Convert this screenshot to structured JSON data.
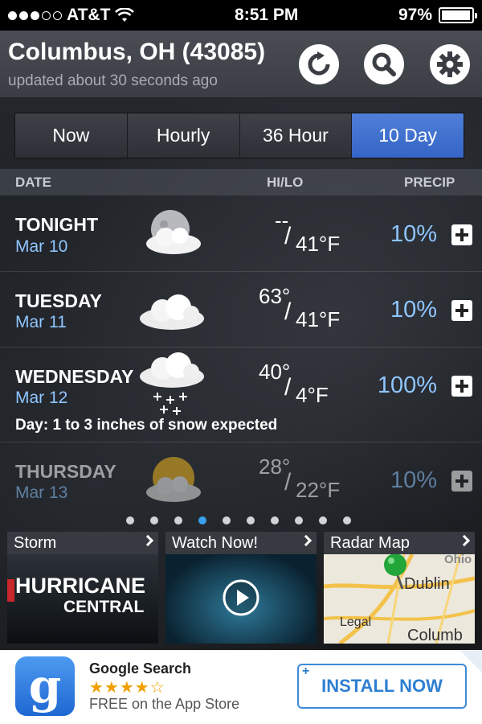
{
  "status_bar": {
    "carrier": "AT&T",
    "time": "8:51 PM",
    "battery": "97%",
    "battery_level": 0.97
  },
  "header": {
    "location": "Columbus, OH (43085)",
    "updated": "updated about 30 seconds ago",
    "icons": [
      "refresh-icon",
      "search-icon",
      "gear-icon"
    ]
  },
  "tabs": [
    {
      "label": "Now",
      "active": false
    },
    {
      "label": "Hourly",
      "active": false
    },
    {
      "label": "36 Hour",
      "active": false
    },
    {
      "label": "10 Day",
      "active": true
    }
  ],
  "columns": {
    "date": "DATE",
    "hilo": "HI/LO",
    "precip": "PRECIP"
  },
  "forecast": [
    {
      "day": "TONIGHT",
      "date": "Mar 10",
      "hi": "--",
      "lo": "41°F",
      "precip": "10%",
      "icon": "moon-cloud-icon",
      "note": ""
    },
    {
      "day": "TUESDAY",
      "date": "Mar 11",
      "hi": "63°",
      "lo": "41°F",
      "precip": "10%",
      "icon": "cloud-icon",
      "note": ""
    },
    {
      "day": "WEDNESDAY",
      "date": "Mar 12",
      "hi": "40°",
      "lo": "4°F",
      "precip": "100%",
      "icon": "snow-cloud-icon",
      "note": "Day: 1 to 3 inches of snow expected"
    },
    {
      "day": "THURSDAY",
      "date": "Mar 13",
      "hi": "28°",
      "lo": "22°F",
      "precip": "10%",
      "icon": "sun-cloud-icon",
      "note": ""
    }
  ],
  "pagination": {
    "count": 10,
    "active_index": 3
  },
  "cards": [
    {
      "title": "Storm",
      "caption_line1": "HURRICANE",
      "caption_line2": "CENTRAL"
    },
    {
      "title": "Watch Now!"
    },
    {
      "title": "Radar Map",
      "labels": [
        "Ohio",
        "Dublin",
        "Legal",
        "Columb"
      ]
    }
  ],
  "ad": {
    "title": "Google Search",
    "rating": "★★★★☆",
    "subtitle": "FREE on the App Store",
    "button": "INSTALL NOW",
    "button_plus": "+",
    "logo_letter": "g",
    "colors": {
      "accent": "#3c8bd9",
      "logo": "#2d7be0"
    }
  },
  "colors": {
    "tab_active": "#3f70cf",
    "date_blue": "#8fc6ff",
    "dot_active": "#3aa0ef"
  }
}
